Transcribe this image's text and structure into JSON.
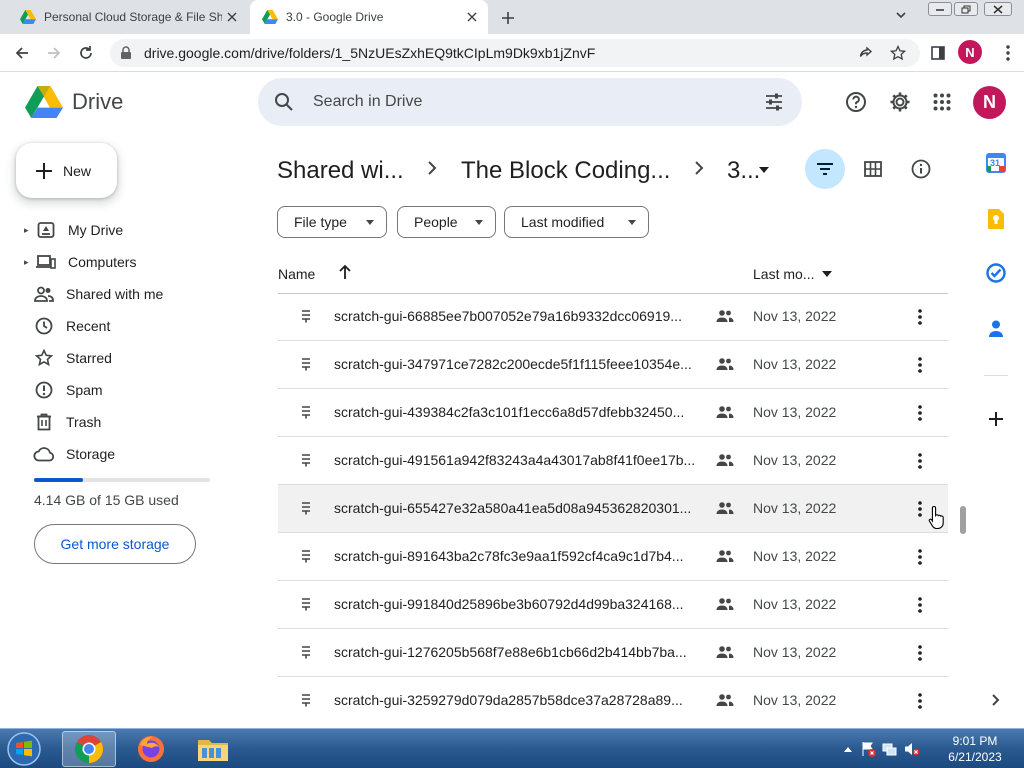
{
  "browser": {
    "tabs": [
      {
        "title": "Personal Cloud Storage & File Sh"
      },
      {
        "title": "3.0 - Google Drive"
      }
    ],
    "url": "drive.google.com/drive/folders/1_5NzUEsZxhEQ9tkCIpLm9Dk9xb1jZnvF",
    "profile_initial": "N"
  },
  "app": {
    "name": "Drive",
    "search_placeholder": "Search in Drive",
    "avatar_initial": "N"
  },
  "sidebar": {
    "new_label": "New",
    "items": [
      {
        "label": "My Drive",
        "icon": "my-drive-icon",
        "expandable": true
      },
      {
        "label": "Computers",
        "icon": "computers-icon",
        "expandable": true
      },
      {
        "label": "Shared with me",
        "icon": "shared-with-me-icon",
        "expandable": false
      },
      {
        "label": "Recent",
        "icon": "clock-icon",
        "expandable": false
      },
      {
        "label": "Starred",
        "icon": "star-icon",
        "expandable": false
      },
      {
        "label": "Spam",
        "icon": "spam-icon",
        "expandable": false
      },
      {
        "label": "Trash",
        "icon": "trash-icon",
        "expandable": false
      },
      {
        "label": "Storage",
        "icon": "cloud-icon",
        "expandable": false
      }
    ],
    "storage": {
      "used_text": "4.14 GB of 15 GB used",
      "used_fraction": 0.276,
      "get_more_label": "Get more storage"
    }
  },
  "breadcrumb": [
    {
      "label": "Shared wi..."
    },
    {
      "label": "The Block Coding..."
    },
    {
      "label": "3..."
    }
  ],
  "filters": {
    "chips": [
      {
        "label": "File type"
      },
      {
        "label": "People"
      },
      {
        "label": "Last modified"
      }
    ]
  },
  "table": {
    "columns": {
      "name": "Name",
      "modified": "Last mo..."
    },
    "rows": [
      {
        "name": "scratch-gui-66885ee7b007052e79a16b9332dcc06919...",
        "date": "Nov 13, 2022"
      },
      {
        "name": "scratch-gui-347971ce7282c200ecde5f1f115feee10354e...",
        "date": "Nov 13, 2022"
      },
      {
        "name": "scratch-gui-439384c2fa3c101f1ecc6a8d57dfebb32450...",
        "date": "Nov 13, 2022"
      },
      {
        "name": "scratch-gui-491561a942f83243a4a43017ab8f41f0ee17b...",
        "date": "Nov 13, 2022"
      },
      {
        "name": "scratch-gui-655427e32a580a41ea5d08a945362820301...",
        "date": "Nov 13, 2022"
      },
      {
        "name": "scratch-gui-891643ba2c78fc3e9aa1f592cf4ca9c1d7b4...",
        "date": "Nov 13, 2022"
      },
      {
        "name": "scratch-gui-991840d25896be3b60792d4d99ba324168...",
        "date": "Nov 13, 2022"
      },
      {
        "name": "scratch-gui-1276205b568f7e88e6b1cb66d2b414bb7ba...",
        "date": "Nov 13, 2022"
      },
      {
        "name": "scratch-gui-3259279d079da2857b58dce37a28728a89...",
        "date": "Nov 13, 2022"
      }
    ]
  },
  "side_panel": {
    "calendar_day": "31"
  },
  "taskbar": {
    "time": "9:01 PM",
    "date": "6/21/2023"
  },
  "colors": {
    "accent": "#0b57d0",
    "avatar": "#c2185b",
    "search_bg": "#e9eef6"
  }
}
